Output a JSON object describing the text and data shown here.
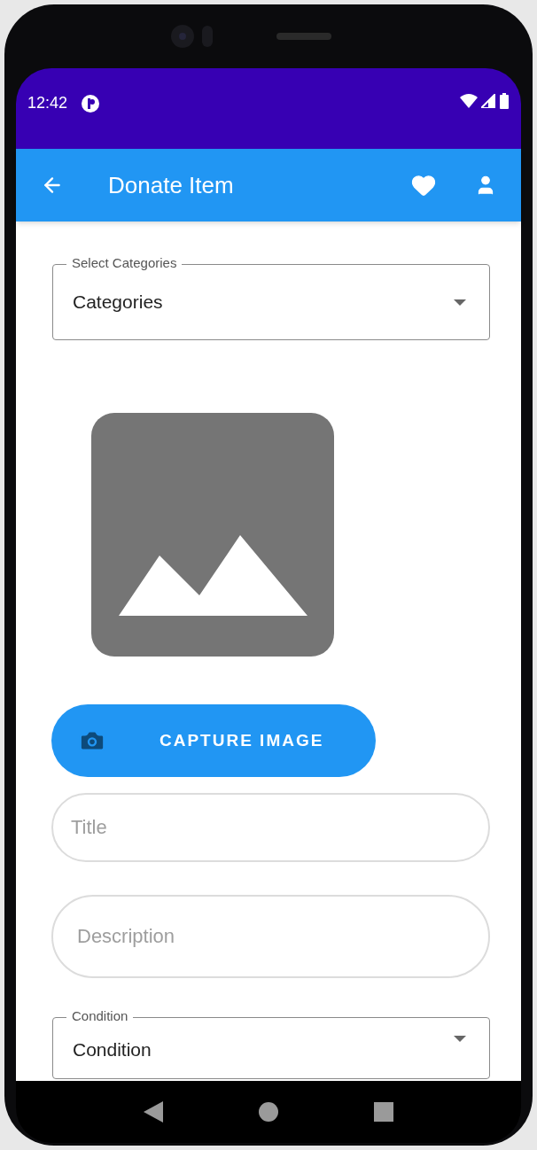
{
  "status_bar": {
    "time": "12:42"
  },
  "app_bar": {
    "title": "Donate Item"
  },
  "form": {
    "category_select": {
      "label": "Select Categories",
      "value": "Categories"
    },
    "capture_button": {
      "label": "CAPTURE IMAGE"
    },
    "title_field": {
      "placeholder": "Title"
    },
    "description_field": {
      "placeholder": "Description"
    },
    "condition_select": {
      "label": "Condition",
      "value": "Condition"
    }
  }
}
